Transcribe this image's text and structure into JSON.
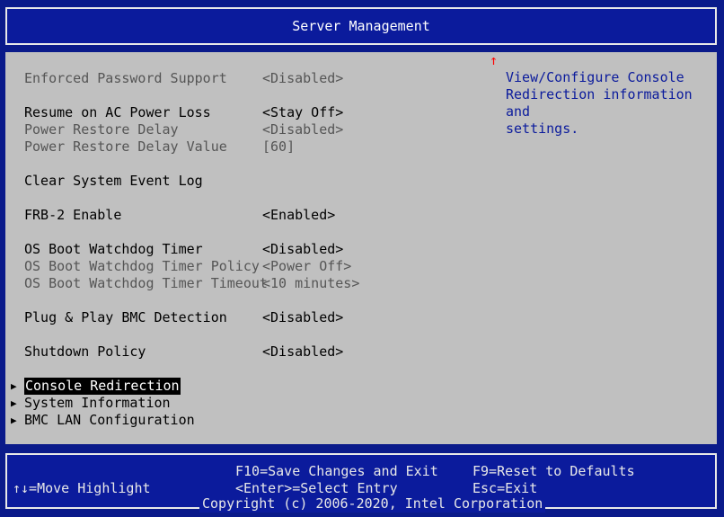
{
  "header": {
    "title": "Server Management"
  },
  "settings": [
    {
      "label": "Enforced Password Support",
      "value": "<Disabled>",
      "state": "dim"
    },
    {
      "label": "Resume on AC Power Loss",
      "value": "<Stay Off>",
      "state": "normal"
    },
    {
      "label": "Power Restore Delay",
      "value": "<Disabled>",
      "state": "dim"
    },
    {
      "label": "Power Restore Delay Value",
      "value": "[60]",
      "state": "dim"
    },
    {
      "label": "Clear System Event Log",
      "value": "",
      "state": "normal"
    },
    {
      "label": "FRB-2 Enable",
      "value": "<Enabled>",
      "state": "normal"
    },
    {
      "label": "OS Boot Watchdog Timer",
      "value": "<Disabled>",
      "state": "normal"
    },
    {
      "label": "OS Boot Watchdog Timer Policy",
      "value": "<Power Off>",
      "state": "dim"
    },
    {
      "label": "OS Boot Watchdog Timer Timeout",
      "value": "<10 minutes>",
      "state": "dim"
    },
    {
      "label": "Plug & Play BMC Detection",
      "value": "<Disabled>",
      "state": "normal"
    },
    {
      "label": "Shutdown Policy",
      "value": "<Disabled>",
      "state": "normal"
    }
  ],
  "submenus": [
    {
      "label": "Console Redirection",
      "selected": true
    },
    {
      "label": "System Information",
      "selected": false
    },
    {
      "label": "BMC LAN Configuration",
      "selected": false
    }
  ],
  "submenu_marker": "▶",
  "scroll_indicator": "↑",
  "help_text": "View/Configure Console\nRedirection information and\nsettings.",
  "footer": {
    "move": "↑↓=Move Highlight",
    "save": "F10=Save Changes and Exit",
    "select": "<Enter>=Select Entry",
    "reset": "F9=Reset to Defaults",
    "exit": "Esc=Exit",
    "copyright": "Copyright (c) 2006-2020, Intel Corporation"
  },
  "colors": {
    "frame_blue": "#0b1b9c",
    "panel_gray": "#c0c0c0",
    "help_text": "#0b1b9c",
    "disabled_text": "#555555",
    "scroll_arrow": "#ff0000"
  }
}
